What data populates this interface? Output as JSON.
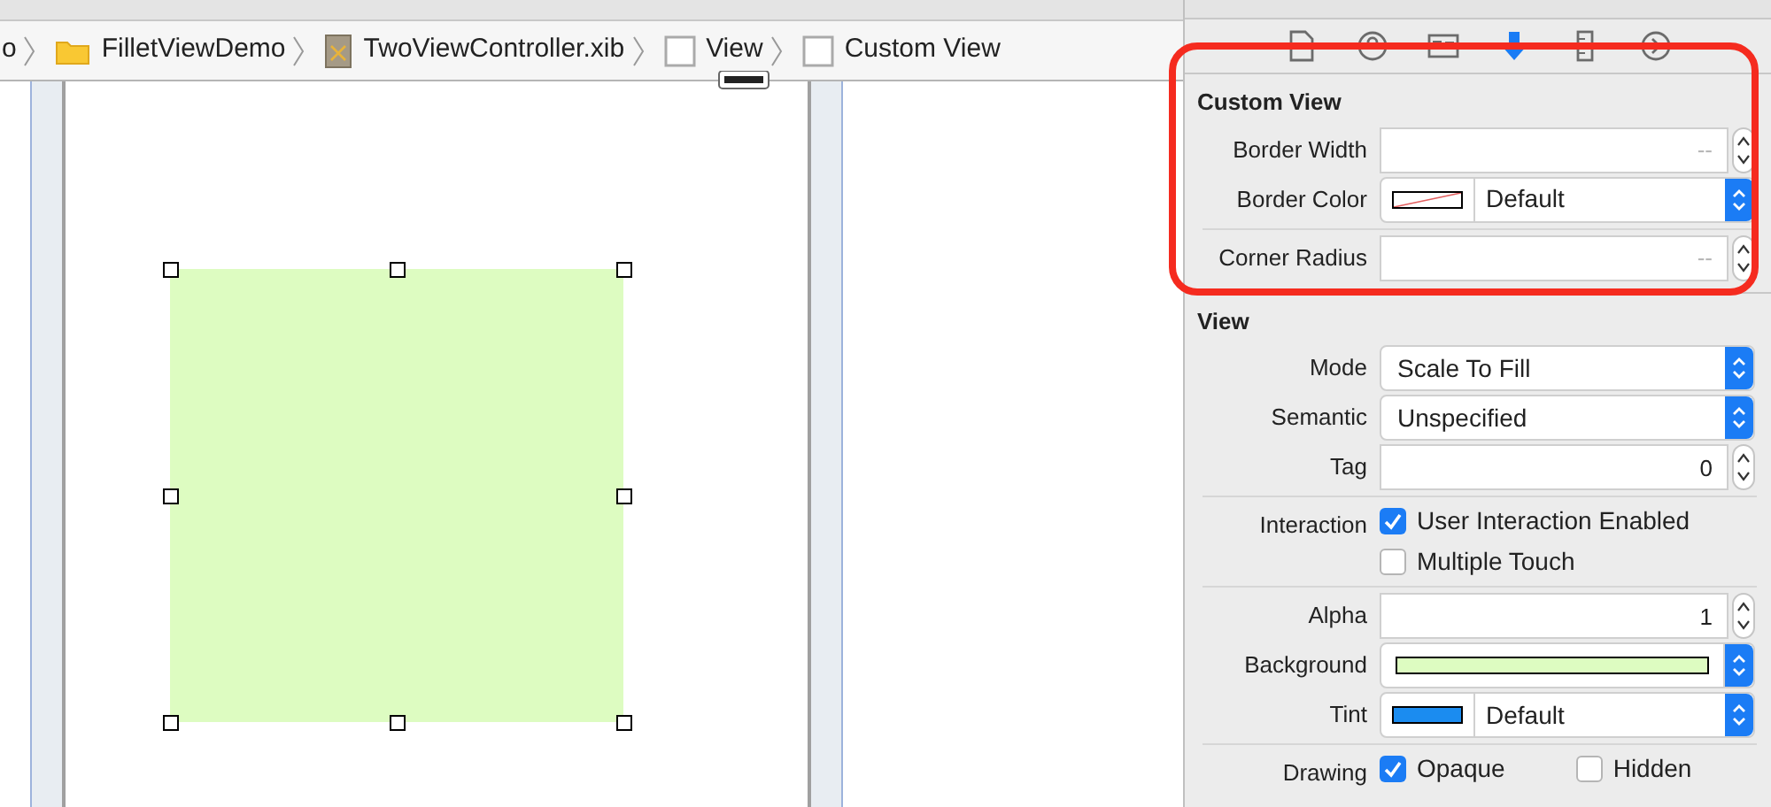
{
  "breadcrumbs": [
    {
      "label": "o",
      "kind": "plain"
    },
    {
      "label": "FilletViewDemo",
      "kind": "folder"
    },
    {
      "label": "TwoViewController.xib",
      "kind": "xib"
    },
    {
      "label": "View",
      "kind": "view"
    },
    {
      "label": "Custom View",
      "kind": "view"
    }
  ],
  "inspector_tabs": [
    {
      "selected": false
    },
    {
      "selected": false
    },
    {
      "selected": false
    },
    {
      "selected": true
    },
    {
      "selected": false
    },
    {
      "selected": false
    }
  ],
  "sections": [
    {
      "title": "Custom View",
      "highlighted": true,
      "rows": [
        {
          "kind": "number",
          "label": "Border Width",
          "placeholder": "--"
        },
        {
          "kind": "color_popup",
          "label": "Border Color",
          "value": "Default"
        },
        {
          "kind": "divider"
        },
        {
          "kind": "number",
          "label": "Corner Radius",
          "placeholder": "--"
        }
      ]
    },
    {
      "title": "View",
      "rows": [
        {
          "kind": "popup",
          "label": "Mode",
          "value": "Scale To Fill"
        },
        {
          "kind": "popup",
          "label": "Semantic",
          "value": "Unspecified"
        },
        {
          "kind": "number",
          "label": "Tag",
          "value": "0"
        },
        {
          "kind": "divider"
        },
        {
          "kind": "checks",
          "label": "Interaction",
          "items": [
            {
              "label": "User Interaction Enabled",
              "checked": true
            },
            {
              "label": "Multiple Touch",
              "checked": false
            }
          ]
        },
        {
          "kind": "divider"
        },
        {
          "kind": "number",
          "label": "Alpha",
          "value": "1"
        },
        {
          "kind": "color_well",
          "label": "Background",
          "color": "#ddfcc1"
        },
        {
          "kind": "color_popup",
          "label": "Tint",
          "color": "#1b8cf0",
          "value": "Default"
        },
        {
          "kind": "divider"
        },
        {
          "kind": "checks",
          "label": "Drawing",
          "inline": true,
          "items": [
            {
              "label": "Opaque",
              "checked": true
            },
            {
              "label": "Hidden",
              "checked": false
            }
          ]
        }
      ]
    }
  ]
}
